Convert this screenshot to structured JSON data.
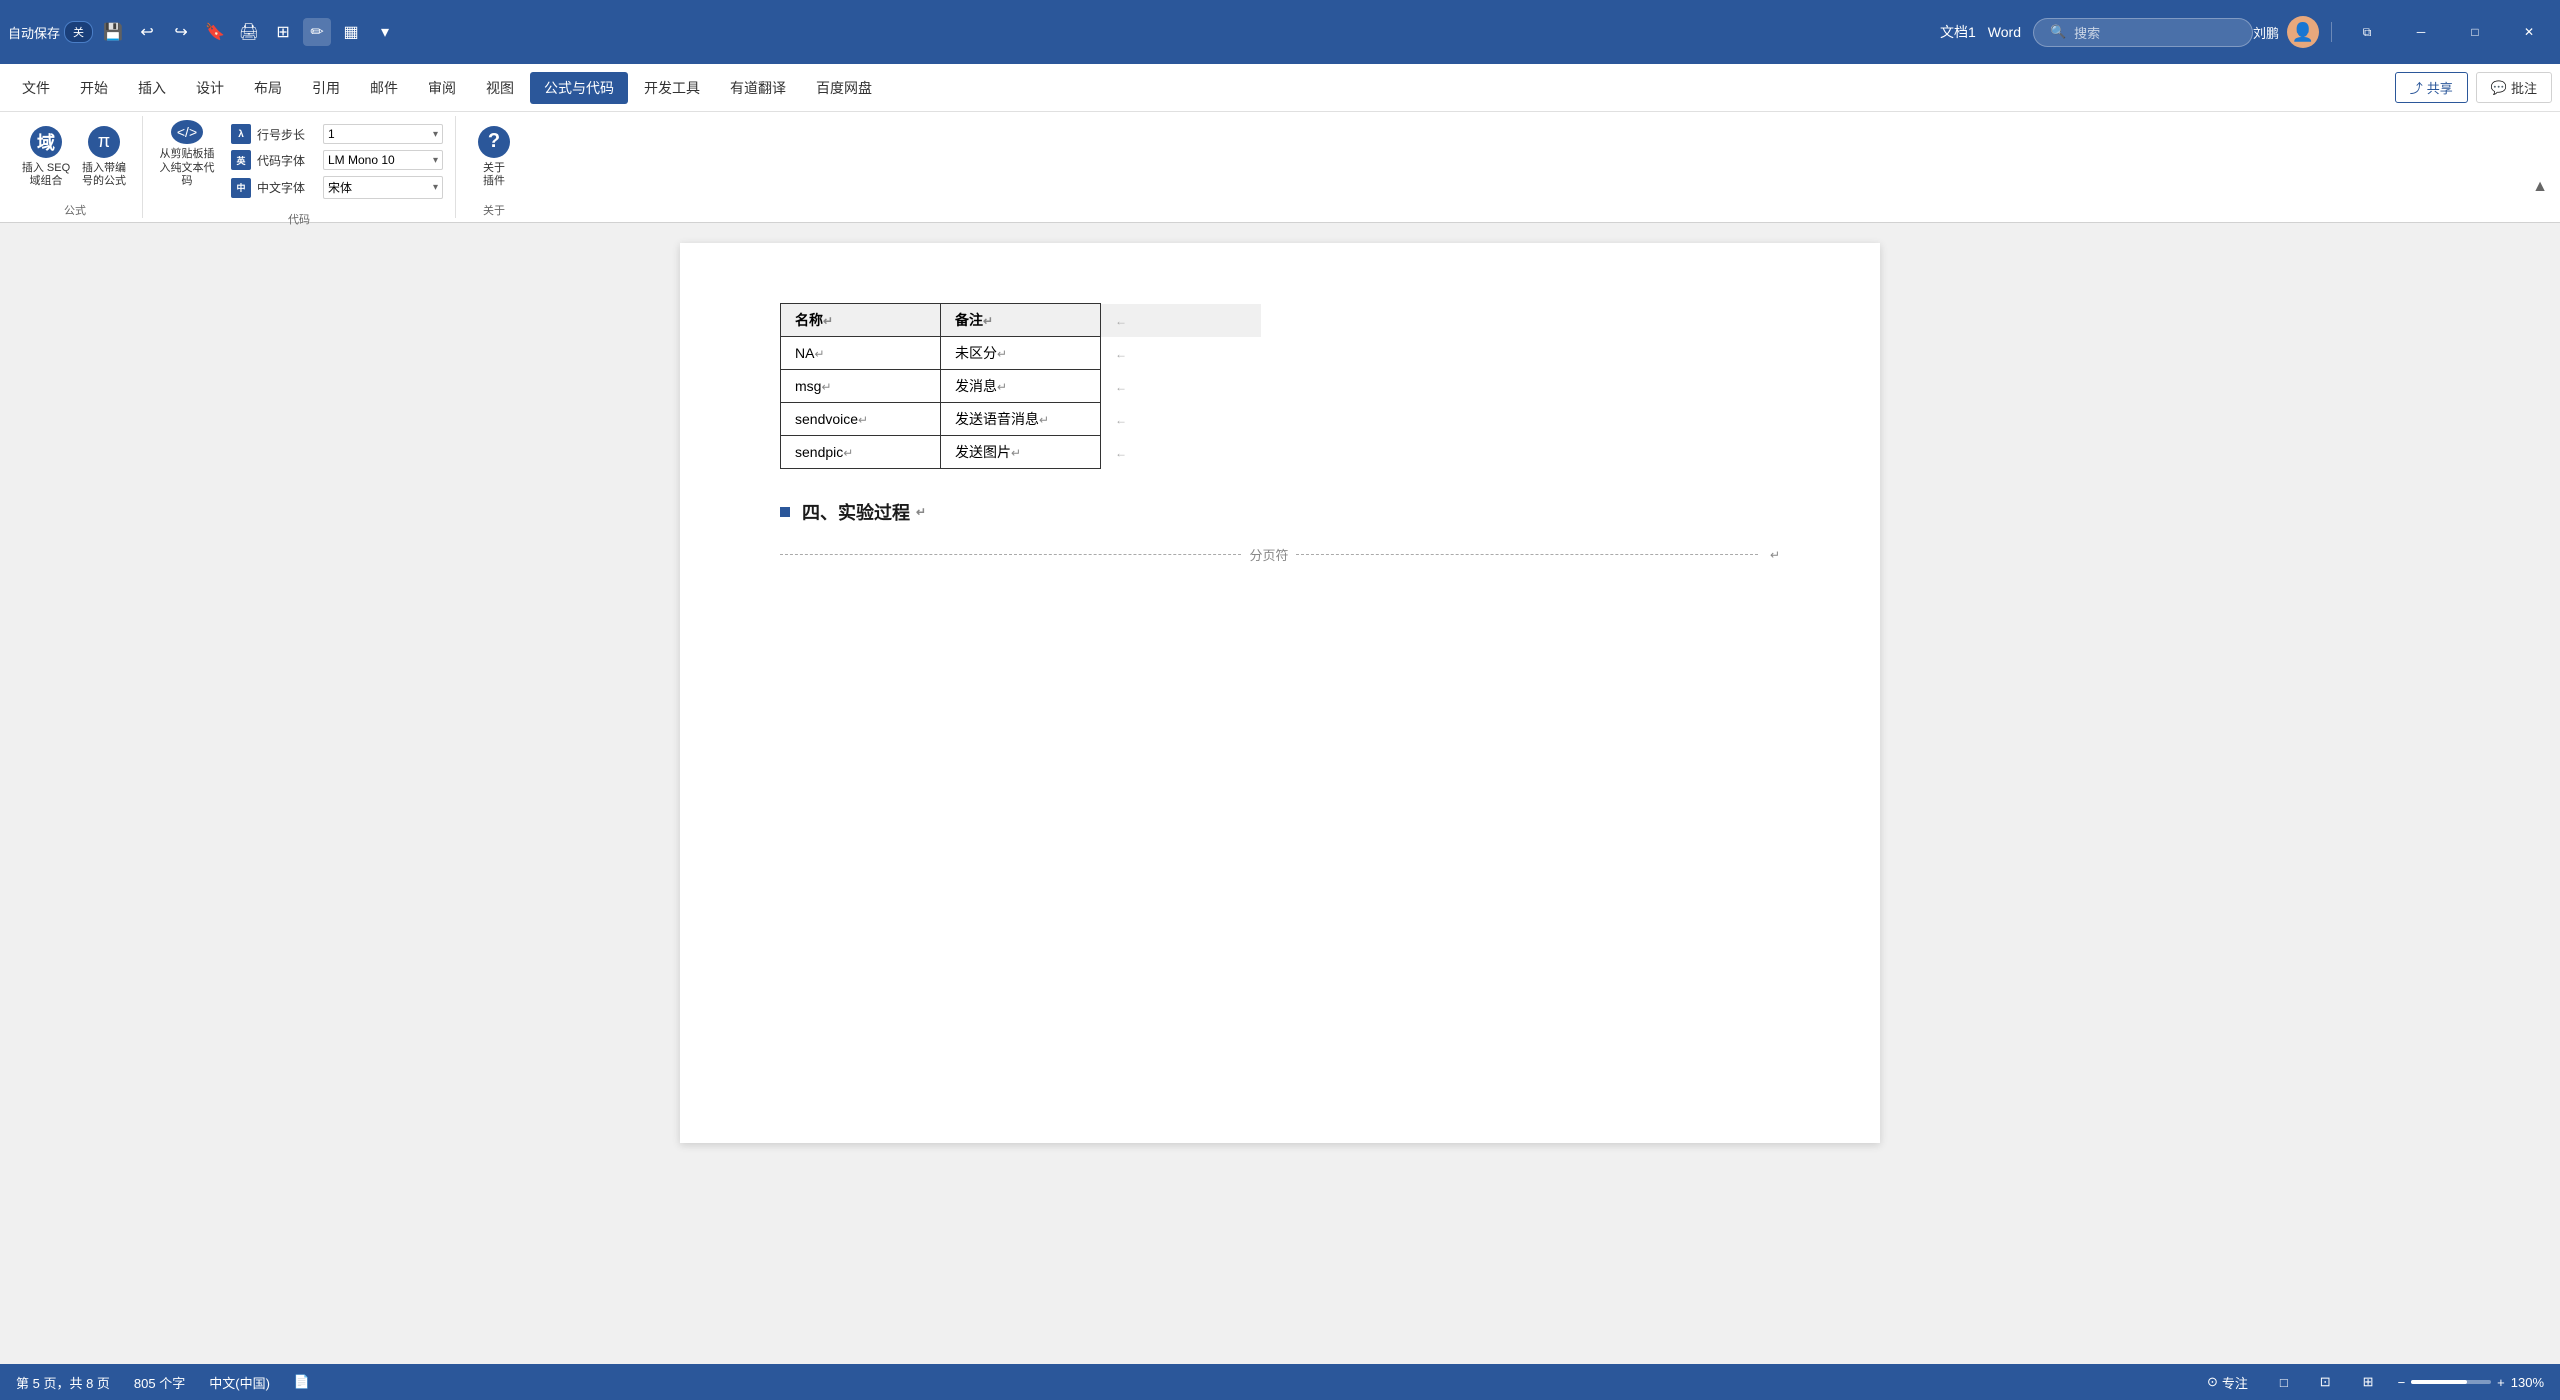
{
  "titlebar": {
    "autosave_label": "自动保存",
    "toggle_state": "关",
    "doc_title": "文档1",
    "app_name": "Word",
    "search_placeholder": "搜索",
    "user_name": "刘鹏",
    "minimize": "─",
    "maximize": "□",
    "close": "✕"
  },
  "menu": {
    "items": [
      {
        "label": "文件",
        "active": false
      },
      {
        "label": "开始",
        "active": false
      },
      {
        "label": "插入",
        "active": false
      },
      {
        "label": "设计",
        "active": false
      },
      {
        "label": "布局",
        "active": false
      },
      {
        "label": "引用",
        "active": false
      },
      {
        "label": "邮件",
        "active": false
      },
      {
        "label": "审阅",
        "active": false
      },
      {
        "label": "视图",
        "active": false
      },
      {
        "label": "公式与代码",
        "active": true
      },
      {
        "label": "开发工具",
        "active": false
      },
      {
        "label": "有道翻译",
        "active": false
      },
      {
        "label": "百度网盘",
        "active": false
      }
    ],
    "share_label": "共享",
    "comment_label": "批注"
  },
  "toolbar": {
    "formula_group_label": "公式",
    "code_group_label": "代码",
    "about_group_label": "关于",
    "insert_domain_label": "插入 SEQ\n域组合",
    "insert_formula_label": "插入带编\n号的公式",
    "paste_plain_label": "从剪贴板插\n入纯文本代码",
    "line_step_label": "行号步长",
    "line_step_value": "1",
    "en_font_label": "代码字体",
    "en_font_value": "LM Mono 10",
    "cn_font_label": "中文字体",
    "cn_font_value": "宋体",
    "about_plugin_label": "关于\n插件"
  },
  "document": {
    "table": {
      "headers": [
        "名称",
        "备注"
      ],
      "rows": [
        {
          "col1": "NA",
          "col2": "未区分"
        },
        {
          "col1": "msg",
          "col2": "发消息"
        },
        {
          "col1": "sendvoice",
          "col2": "发送语音消息"
        },
        {
          "col1": "sendpic",
          "col2": "发送图片"
        }
      ]
    },
    "section4": "四、实验过程",
    "page_break_label": "分页符"
  },
  "statusbar": {
    "page_info": "第 5 页，共 8 页",
    "word_count": "805 个字",
    "language": "中文(中国)",
    "focus_label": "专注",
    "view_print": "□",
    "view_web": "⊡",
    "view_read": "⊞",
    "zoom_percent": "130%",
    "zoom_minus": "−",
    "zoom_plus": "+"
  }
}
